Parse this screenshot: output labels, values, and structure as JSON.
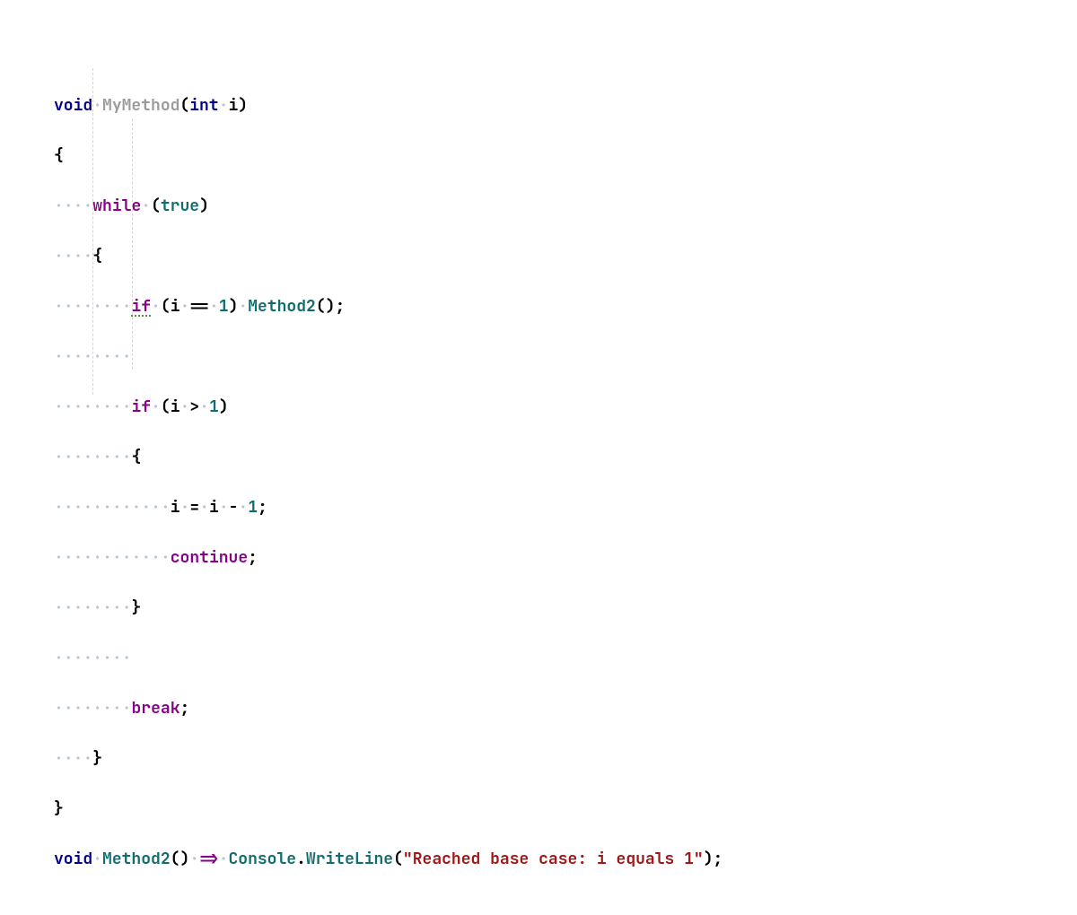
{
  "colors": {
    "keyword": "#00008b",
    "control_flow": "#8b008b",
    "method_declared": "#9b9b9b",
    "method_call": "#0f6d6d",
    "literal": "#0f6d6d",
    "string": "#a31515",
    "whitespace_marker": "#b8c4d0",
    "guide": "#cfd6dd"
  },
  "whitespace_marker": "·",
  "tokens": {
    "void": "void",
    "int": "int",
    "while": "while",
    "true": "true",
    "if": "if",
    "continue": "continue",
    "break": "break",
    "arrow": "=>",
    "MyMethod": "MyMethod",
    "Method2": "Method2",
    "Console": "Console",
    "WriteLine": "WriteLine",
    "i": "i",
    "one": "1",
    "eq": "==",
    "gt": ">",
    "assign": "=",
    "minus": "-",
    "lparen": "(",
    "rparen": ")",
    "lbrace": "{",
    "rbrace": "}",
    "semi": ";",
    "dot": ".",
    "string_literal": "\"Reached base case: i equals 1\""
  },
  "indent_guides_char_cols": [
    4,
    8
  ],
  "lines_description": [
    "void MyMethod(int i)",
    "{",
    "    while (true)",
    "    {",
    "        if (i == 1) Method2();",
    "        ",
    "        if (i > 1)",
    "        {",
    "            i = i - 1;",
    "            continue;",
    "        }",
    "        ",
    "        break;",
    "    }",
    "}",
    "void Method2() => Console.WriteLine(\"Reached base case: i equals 1\");"
  ]
}
